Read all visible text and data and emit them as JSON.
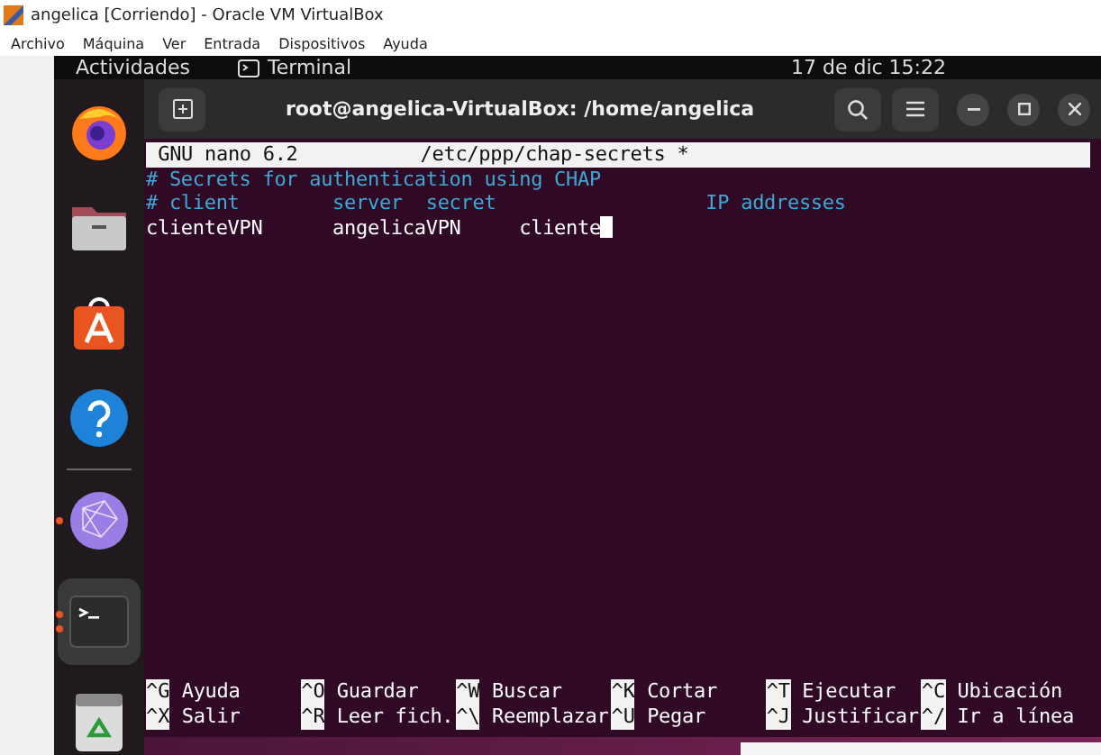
{
  "window": {
    "title": "angelica [Corriendo] - Oracle VM VirtualBox"
  },
  "menu": [
    "Archivo",
    "Máquina",
    "Ver",
    "Entrada",
    "Dispositivos",
    "Ayuda"
  ],
  "top_bar": {
    "activities": "Actividades",
    "app": "Terminal",
    "clock": "17 de dic  15:22"
  },
  "dock": [
    {
      "kind": "browser",
      "running": false,
      "multiple_windows": false,
      "selected": false
    },
    {
      "kind": "files",
      "running": false,
      "multiple_windows": false,
      "selected": false
    },
    {
      "kind": "store",
      "running": false,
      "multiple_windows": false,
      "selected": false
    },
    {
      "kind": "help",
      "running": false,
      "multiple_windows": false,
      "selected": false
    },
    {
      "kind": "separator"
    },
    {
      "kind": "globe",
      "running": true,
      "multiple_windows": false,
      "selected": false
    },
    {
      "kind": "terminal",
      "running": true,
      "multiple_windows": true,
      "selected": true
    },
    {
      "kind": "trash",
      "running": false,
      "multiple_windows": false,
      "selected": false
    }
  ],
  "terminal": {
    "title": "root@angelica-VirtualBox: /home/angelica",
    "nano_version": "GNU nano 6.2",
    "file": "/etc/ppp/chap-secrets *",
    "lines": [
      {
        "text": "# Secrets for authentication using CHAP",
        "kind": "comment"
      },
      {
        "text": "# client        server  secret                  IP addresses",
        "kind": "comment"
      },
      {
        "text": "clienteVPN      angelicaVPN     cliente",
        "kind": "text",
        "cursor": true
      }
    ],
    "shortcuts": [
      {
        "key": "^G",
        "label": "Ayuda"
      },
      {
        "key": "^O",
        "label": "Guardar"
      },
      {
        "key": "^W",
        "label": "Buscar"
      },
      {
        "key": "^K",
        "label": "Cortar"
      },
      {
        "key": "^T",
        "label": "Ejecutar"
      },
      {
        "key": "^C",
        "label": "Ubicación"
      },
      {
        "key": "^X",
        "label": "Salir"
      },
      {
        "key": "^R",
        "label": "Leer fich."
      },
      {
        "key": "^\\",
        "label": "Reemplazar"
      },
      {
        "key": "^U",
        "label": "Pegar"
      },
      {
        "key": "^J",
        "label": "Justificar"
      },
      {
        "key": "^/",
        "label": "Ir a línea"
      }
    ]
  }
}
